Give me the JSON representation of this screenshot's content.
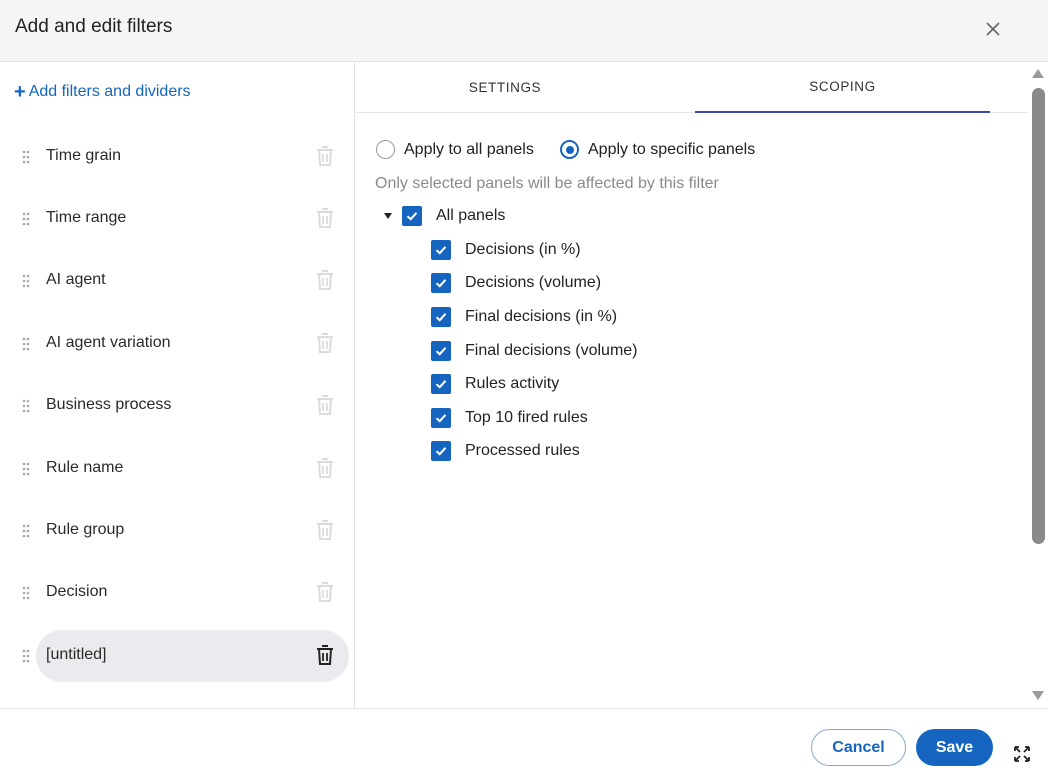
{
  "dialog": {
    "title": "Add and edit filters"
  },
  "left_panel": {
    "add_link": "Add filters and dividers",
    "filters": [
      {
        "label": "Time grain",
        "selected": false
      },
      {
        "label": "Time range",
        "selected": false
      },
      {
        "label": "AI agent",
        "selected": false
      },
      {
        "label": "AI agent variation",
        "selected": false
      },
      {
        "label": "Business process",
        "selected": false
      },
      {
        "label": "Rule name",
        "selected": false
      },
      {
        "label": "Rule group",
        "selected": false
      },
      {
        "label": "Decision",
        "selected": false
      },
      {
        "label": "[untitled]",
        "selected": true
      }
    ]
  },
  "tabs": [
    {
      "label": "SETTINGS",
      "active": false
    },
    {
      "label": "SCOPING",
      "active": true
    }
  ],
  "scoping": {
    "radio_all": {
      "label": "Apply to all panels",
      "checked": false
    },
    "radio_specific": {
      "label": "Apply to specific panels",
      "checked": true
    },
    "hint": "Only selected panels will be affected by this filter",
    "root": {
      "label": "All panels",
      "checked": true,
      "expanded": true
    },
    "panels": [
      {
        "label": "Decisions (in %)",
        "checked": true
      },
      {
        "label": "Decisions (volume)",
        "checked": true
      },
      {
        "label": "Final decisions (in %)",
        "checked": true
      },
      {
        "label": "Final decisions (volume)",
        "checked": true
      },
      {
        "label": "Rules activity",
        "checked": true
      },
      {
        "label": "Top 10 fired rules",
        "checked": true
      },
      {
        "label": "Processed rules",
        "checked": true
      }
    ]
  },
  "footer": {
    "cancel_label": "Cancel",
    "save_label": "Save"
  },
  "colors": {
    "accent": "#1565c0",
    "selected_row_bg": "#ebebef",
    "header_bg": "#f5f5f5",
    "tab_underline": "#3a4aa0"
  },
  "icons": {
    "close": "close-icon",
    "add": "plus-icon",
    "drag": "drag-handle-icon",
    "delete": "trash-icon",
    "expand": "expand-icon",
    "caret": "caret-down-icon",
    "check": "check-icon"
  }
}
